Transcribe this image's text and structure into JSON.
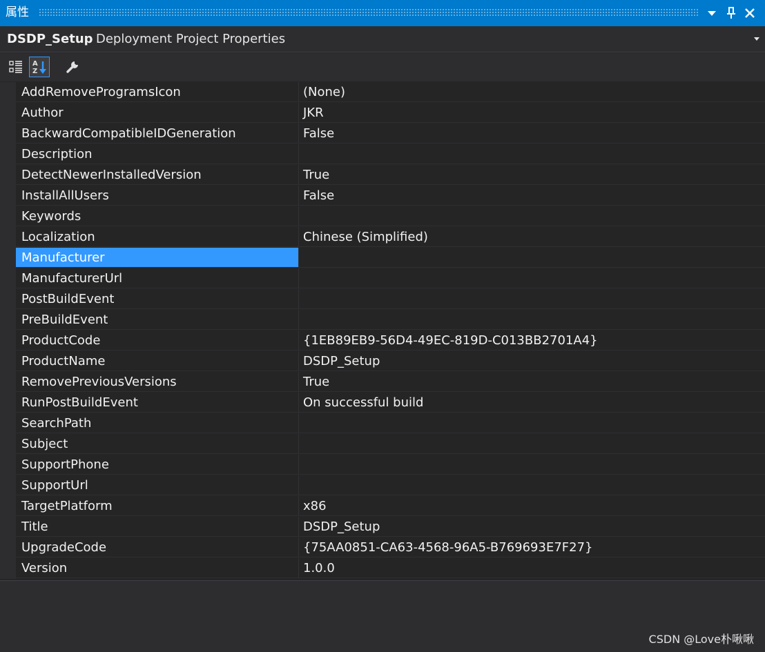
{
  "window": {
    "title": "属性"
  },
  "header": {
    "object_name": "DSDP_Setup",
    "object_type": "Deployment Project Properties"
  },
  "toolbar": {
    "categorized_icon": "categorized-view-icon",
    "alphabetical_icon": "alphabetical-sort-icon",
    "property_pages_icon": "wrench-icon",
    "active": "alphabetical"
  },
  "properties": [
    {
      "name": "AddRemoveProgramsIcon",
      "value": "(None)"
    },
    {
      "name": "Author",
      "value": "JKR"
    },
    {
      "name": "BackwardCompatibleIDGeneration",
      "value": "False"
    },
    {
      "name": "Description",
      "value": ""
    },
    {
      "name": "DetectNewerInstalledVersion",
      "value": "True"
    },
    {
      "name": "InstallAllUsers",
      "value": "False"
    },
    {
      "name": "Keywords",
      "value": ""
    },
    {
      "name": "Localization",
      "value": "Chinese (Simplified)"
    },
    {
      "name": "Manufacturer",
      "value": "",
      "selected": true
    },
    {
      "name": "ManufacturerUrl",
      "value": ""
    },
    {
      "name": "PostBuildEvent",
      "value": ""
    },
    {
      "name": "PreBuildEvent",
      "value": ""
    },
    {
      "name": "ProductCode",
      "value": "{1EB89EB9-56D4-49EC-819D-C013BB2701A4}"
    },
    {
      "name": "ProductName",
      "value": "DSDP_Setup"
    },
    {
      "name": "RemovePreviousVersions",
      "value": "True"
    },
    {
      "name": "RunPostBuildEvent",
      "value": "On successful build"
    },
    {
      "name": "SearchPath",
      "value": ""
    },
    {
      "name": "Subject",
      "value": ""
    },
    {
      "name": "SupportPhone",
      "value": ""
    },
    {
      "name": "SupportUrl",
      "value": ""
    },
    {
      "name": "TargetPlatform",
      "value": "x86"
    },
    {
      "name": "Title",
      "value": "DSDP_Setup"
    },
    {
      "name": "UpgradeCode",
      "value": "{75AA0851-CA63-4568-96A5-B769693E7F27}"
    },
    {
      "name": "Version",
      "value": "1.0.0"
    }
  ],
  "watermark": "CSDN @Love朴啾啾",
  "colors": {
    "title_bar": "#007acc",
    "background": "#252526",
    "selection": "#3399ff",
    "text": "#f1f1f1"
  }
}
